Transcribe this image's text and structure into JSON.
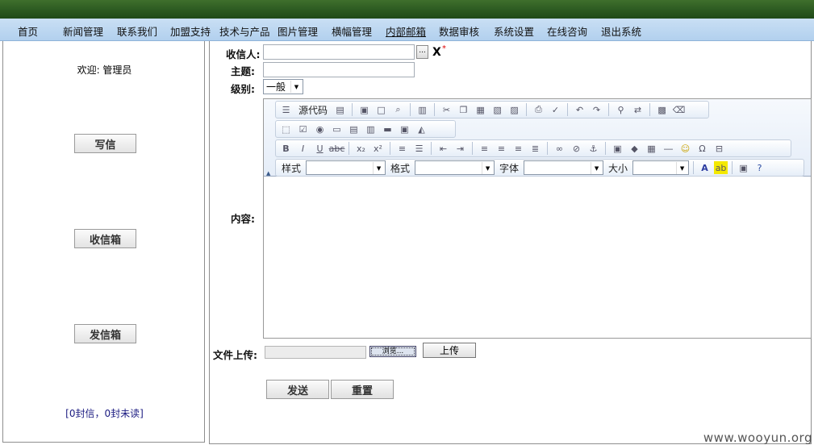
{
  "nav": {
    "items": [
      {
        "label": "首页"
      },
      {
        "label": "新闻管理"
      },
      {
        "label": "联系我们"
      },
      {
        "label": "加盟支持"
      },
      {
        "label": "技术与产品"
      },
      {
        "label": "图片管理"
      },
      {
        "label": "横幅管理"
      },
      {
        "label": "内部邮箱"
      },
      {
        "label": "数据审核"
      },
      {
        "label": "系统设置"
      },
      {
        "label": "在线咨询"
      },
      {
        "label": "退出系统"
      }
    ]
  },
  "sidebar": {
    "welcome": "欢迎: 管理员",
    "write_label": "写信",
    "inbox_label": "收信箱",
    "outbox_label": "发信箱",
    "mail_count": "[0封信，0封未读]"
  },
  "form": {
    "recipient_label": "收信人:",
    "recipient_value": "",
    "browse_dots": "...",
    "clear_mark": "X",
    "required_mark": "*",
    "subject_label": "主题:",
    "subject_value": "",
    "level_label": "级别:",
    "level_value": "一般",
    "content_label": "内容:",
    "upload_label": "文件上传:",
    "browse_label": "浏览...",
    "upload_button": "上传",
    "send_button": "发送",
    "reset_button": "重置"
  },
  "editor": {
    "source_label": "源代码",
    "style_label": "样式",
    "format_label": "格式",
    "font_label": "字体",
    "size_label": "大小",
    "style_value": "",
    "format_value": "",
    "font_value": "",
    "size_value": ""
  },
  "watermark": "www.wooyun.org"
}
